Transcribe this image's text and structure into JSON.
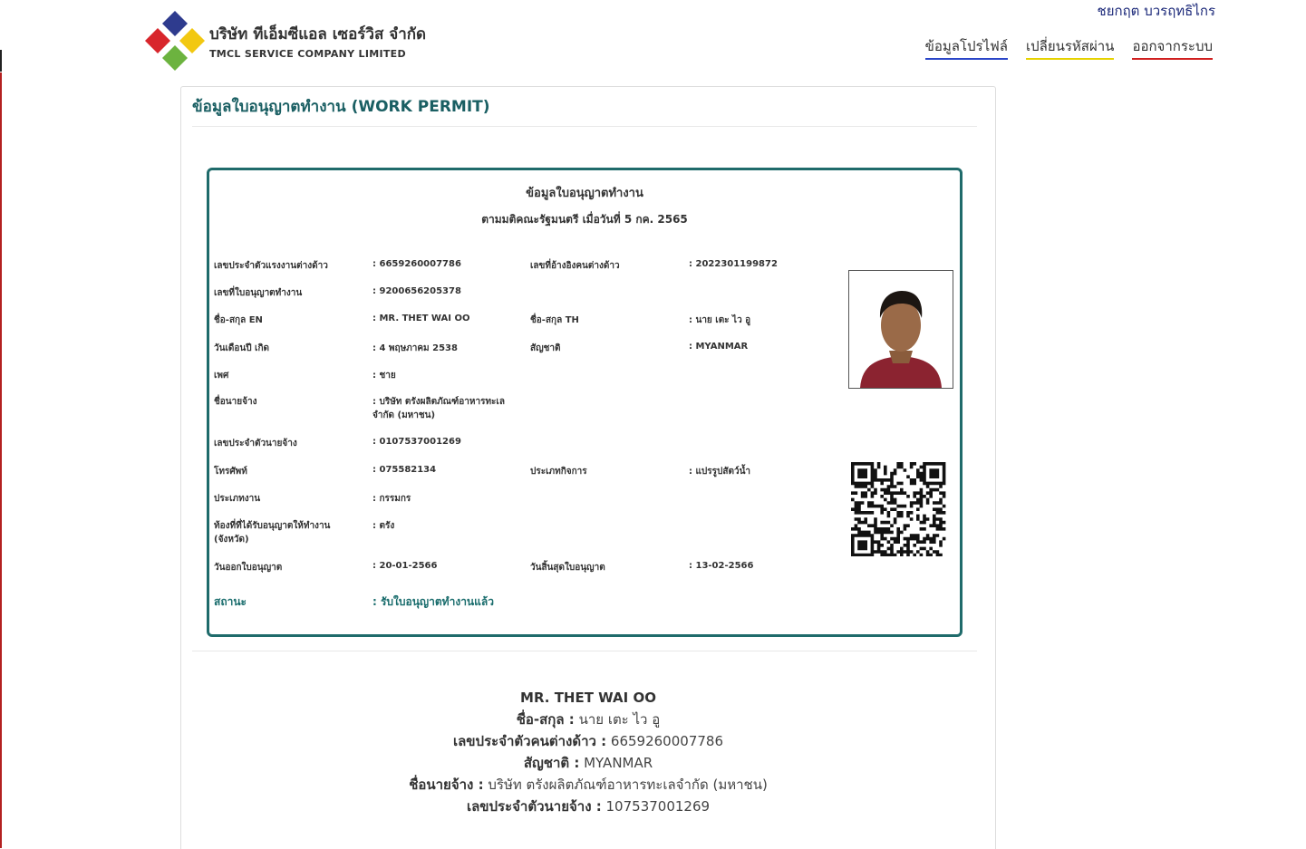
{
  "header": {
    "company_th": "บริษัท ทีเอ็มซีแอล เซอร์วิส จำกัด",
    "company_en": "TMCL SERVICE COMPANY LIMITED",
    "user_name": "ชยกฤต บวรฤทธิไกร",
    "nav": {
      "profile": "ข้อมูลโปรไฟล์",
      "change_password": "เปลี่ยนรหัสผ่าน",
      "logout": "ออกจากระบบ"
    }
  },
  "panel": {
    "title": "ข้อมูลใบอนุญาตทำงาน (WORK PERMIT)"
  },
  "card": {
    "title": "ข้อมูลใบอนุญาตทำงาน",
    "subtitle": "ตามมติคณะรัฐมนตรี เมื่อวันที่ 5 กค. 2565",
    "worker_id_label": "เลขประจำตัวแรงงานต่างด้าว",
    "worker_id": ": 6659260007786",
    "ref_id_label": "เลขที่อ้างอิงคนต่างด้าว",
    "ref_id": ": 2022301199872",
    "permit_no_label": "เลขที่ใบอนุญาตทำงาน",
    "permit_no": ": 9200656205378",
    "name_en_label": "ชื่อ-สกุล EN",
    "name_en": ": MR. THET WAI OO",
    "name_th_label": "ชื่อ-สกุล TH",
    "name_th": ": นาย เตะ ไว อู",
    "dob_label": "วันเดือนปี เกิด",
    "dob": ": 4 พฤษภาคม 2538",
    "nationality_label": "สัญชาติ",
    "nationality": ": MYANMAR",
    "sex_label": "เพศ",
    "sex": ": ชาย",
    "employer_label": "ชื่อนายจ้าง",
    "employer": ": บริษัท ตรังผลิตภัณฑ์อาหารทะเล จำกัด (มหาชน)",
    "employer_id_label": "เลขประจำตัวนายจ้าง",
    "employer_id": ": 0107537001269",
    "phone_label": "โทรศัพท์",
    "phone": ": 075582134",
    "business_label": "ประเภทกิจการ",
    "business": ": แปรรูปสัตว์น้ำ",
    "job_label": "ประเภทงาน",
    "job": ": กรรมกร",
    "province_label": "ท้องที่ที่ได้รับอนุญาตให้ทำงาน (จังหวัด)",
    "province": ": ตรัง",
    "issue_label": "วันออกใบอนุญาต",
    "issue": ": 20-01-2566",
    "expire_label": "วันสิ้นสุดใบอนุญาต",
    "expire": ": 13-02-2566",
    "status_label": "สถานะ",
    "status": ": รับใบอนุญาตทำงานแล้ว"
  },
  "summary": {
    "name_en": "MR. THET WAI OO",
    "name_th_label": "ชื่อ-สกุล :",
    "name_th": " นาย เตะ ไว อู",
    "worker_id_label": "เลขประจำตัวคนต่างด้าว :",
    "worker_id": " 6659260007786",
    "nationality_label": "สัญชาติ :",
    "nationality": " MYANMAR",
    "employer_label": "ชื่อนายจ้าง :",
    "employer": " บริษัท ตรังผลิตภัณฑ์อาหารทะเลจำกัด (มหาชน)",
    "employer_id_label": "เลขประจำตัวนายจ้าง :",
    "employer_id": " 107537001269"
  }
}
